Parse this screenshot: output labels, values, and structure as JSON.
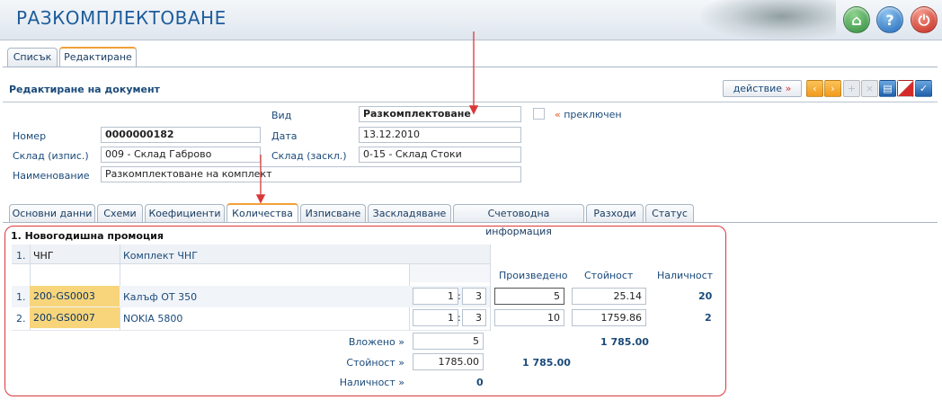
{
  "app": {
    "title": "РАЗКОМПЛЕКТОВАНЕ"
  },
  "top_tabs": [
    {
      "label": "Списък",
      "active": false
    },
    {
      "label": "Редактиране",
      "active": true
    }
  ],
  "panel": {
    "title": "Редактиране на документ",
    "action_label": "действие",
    "action_arrow": "»"
  },
  "form": {
    "type_label": "Вид",
    "type_value": "Разкомплектоване",
    "switched_marker": "«",
    "switched_label": "преключен",
    "number_label": "Номер",
    "number_value": "0000000182",
    "date_label": "Дата",
    "date_value": "13.12.2010",
    "warehouse_out_label": "Склад (изпис.)",
    "warehouse_out_value": "009 - Склад Габрово",
    "warehouse_in_label": "Склад (заскл.)",
    "warehouse_in_value": "0-15 - Склад Стоки",
    "name_label": "Наименование",
    "name_value": "Разкомплектоване на комплект"
  },
  "section_tabs": [
    {
      "label": "Основни данни",
      "active": false
    },
    {
      "label": "Схеми",
      "active": false
    },
    {
      "label": "Коефициенти",
      "active": false
    },
    {
      "label": "Количества",
      "active": true
    },
    {
      "label": "Изписване",
      "active": false
    },
    {
      "label": "Заскладяване",
      "active": false
    },
    {
      "label": "Счетоводна информация",
      "active": false
    },
    {
      "label": "Разходи",
      "active": false
    },
    {
      "label": "Статус",
      "active": false
    }
  ],
  "grid": {
    "group_title": "1. Новогодишна промоция",
    "header": {
      "index": "1.",
      "code": "ЧНГ",
      "name": "Комплект ЧНГ",
      "produced": "Произведено",
      "cost": "Стойност",
      "availability": "Наличност"
    },
    "rows": [
      {
        "index": "1.",
        "code": "200-GS0003",
        "name": "Калъф OT 350",
        "ratio_a": "1",
        "ratio_sep": ":",
        "ratio_b": "3",
        "produced": "5",
        "cost": "25.14",
        "availability": "20"
      },
      {
        "index": "2.",
        "code": "200-GS0007",
        "name": "NOKIA 5800",
        "ratio_a": "1",
        "ratio_sep": ":",
        "ratio_b": "3",
        "produced": "10",
        "cost": "1759.86",
        "availability": "2"
      }
    ],
    "footer": {
      "put_in_label": "Вложено",
      "put_in_value": "5",
      "put_in_total": "1 785.00",
      "cost_label": "Стойност",
      "cost_value": "1785.00",
      "cost_total": "1 785.00",
      "availability_label": "Наличност",
      "availability_value": "0",
      "raquo": "»"
    }
  },
  "colors": {
    "accent": "#1d5c9b",
    "highlight_cell": "#f8d57b",
    "annotation_red": "#d9383a",
    "active_tab_border": "#f1a03a"
  }
}
